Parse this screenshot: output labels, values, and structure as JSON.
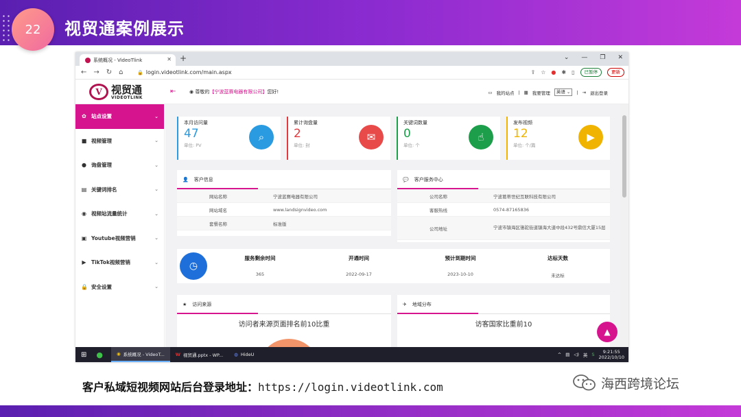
{
  "slide": {
    "number": "22",
    "title": "视贸通案例展示",
    "footer_label": "客户私域短视频网站后台登录地址：",
    "footer_url": "https://login.videotlink.com",
    "watermark": "海西跨境论坛"
  },
  "browser": {
    "tab_title": "系统概况 - VideoTlink",
    "url": "login.videotlink.com/main.aspx",
    "paused_label": "已暂停",
    "update_label": "更新"
  },
  "app": {
    "logo_cn": "视贸通",
    "logo_en": "VIDEOTLINK",
    "greeting_prefix": "尊敬的",
    "company": "【宁波蓝赛电器有限公司】",
    "greeting_suffix": "您好!",
    "my_site": "我的站点",
    "my_management": "我要管理",
    "language": "英语",
    "logout": "退出登录"
  },
  "sidebar": {
    "items": [
      {
        "label": "站点设置",
        "icon": "gear-icon",
        "glyph": "✿"
      },
      {
        "label": "视频管理",
        "icon": "video-icon",
        "glyph": "■"
      },
      {
        "label": "询盘管理",
        "icon": "chat-icon",
        "glyph": "●"
      },
      {
        "label": "关键词排名",
        "icon": "doc-icon",
        "glyph": "▤"
      },
      {
        "label": "视频站流量统计",
        "icon": "globe-icon",
        "glyph": "◉"
      },
      {
        "label": "Youtube视频营销",
        "icon": "youtube-icon",
        "glyph": "▣"
      },
      {
        "label": "TikTok视频营销",
        "icon": "tiktok-icon",
        "glyph": "▶"
      },
      {
        "label": "安全设置",
        "icon": "lock-icon",
        "glyph": "🔒"
      }
    ]
  },
  "stats": [
    {
      "label": "本月访问量",
      "value": "47",
      "unit": "单位: PV",
      "color": "#2a9be0",
      "bg": "#2a9be0",
      "icon": "chart-search-icon",
      "glyph": "⌕"
    },
    {
      "label": "累计询盘量",
      "value": "2",
      "unit": "单位: 封",
      "color": "#e0393e",
      "bg": "#e84a4a",
      "icon": "message-icon",
      "glyph": "✉"
    },
    {
      "label": "关键词数量",
      "value": "0",
      "unit": "单位: 个",
      "color": "#1d9e4a",
      "bg": "#1d9e4a",
      "icon": "fingerprint-icon",
      "glyph": "☝"
    },
    {
      "label": "发布视频",
      "value": "12",
      "unit": "单位: 个/篇",
      "color": "#f0b400",
      "bg": "#f0b400",
      "icon": "play-icon",
      "glyph": "▶"
    }
  ],
  "customer_info": {
    "title": "客户信息",
    "rows": [
      {
        "k": "网站名称",
        "v": "宁波蓝赛电器有限公司"
      },
      {
        "k": "网站域名",
        "v": "www.landsignvideo.com"
      },
      {
        "k": "套餐名称",
        "v": "标准版"
      }
    ]
  },
  "service_center": {
    "title": "客户服务中心",
    "rows": [
      {
        "k": "公司名称",
        "v": "宁波葛蒂世纪互联科技有限公司"
      },
      {
        "k": "客服热线",
        "v": "0574-87165836"
      },
      {
        "k": "公司地址",
        "v": "宁波市镇海区骆驼街道镇海大道中段432号鼎信大厦15层"
      }
    ]
  },
  "service": {
    "cols": [
      {
        "h": "服务剩余时间",
        "v": "365"
      },
      {
        "h": "开通时间",
        "v": "2022-09-17"
      },
      {
        "h": "预计到期时间",
        "v": "2023-10-10"
      },
      {
        "h": "达标天数",
        "v": "未达标"
      }
    ]
  },
  "visits": {
    "title": "访问来源",
    "chart_title": "访问者来源页面排名前10比重"
  },
  "regions": {
    "title": "地域分布",
    "chart_title": "访客国家比重前10"
  },
  "taskbar": {
    "apps": [
      {
        "label": "系统概况 - VideoT..."
      },
      {
        "label": "视贸通.pptx - WP..."
      },
      {
        "label": "HideU"
      }
    ],
    "ime": "英",
    "time": "9:21:55",
    "date": "2022/10/10"
  }
}
